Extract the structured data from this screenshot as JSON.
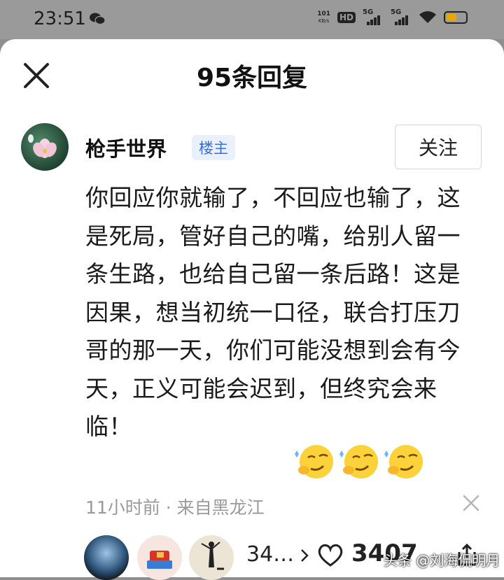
{
  "status_bar": {
    "time": "23:51",
    "net_speed_value": "101",
    "net_speed_unit": "KB/s",
    "hd_label": "HD",
    "sim1_label": "5G",
    "sim2_label": "5G",
    "battery_color": "#e8a800"
  },
  "header": {
    "title": "95条回复",
    "close_icon": "close-icon"
  },
  "comment": {
    "author": "枪手世界",
    "badge": "楼主",
    "follow_label": "关注",
    "text": "你回应你就输了，不回应也输了，这是死局，管好自己的嘴，给别人留一条生路，也给自己留一条后路！这是因果，想当初统一口径，联合打压刀哥的那一天，你们可能没想到会有今天，正义可能会迟到，但终究会来临！",
    "emoji_count": 3,
    "meta": "11小时前 · 来自黑龙江"
  },
  "footer": {
    "likers_count": "34…",
    "like_count": "3407",
    "watermark": "头条 @刘海侃明月"
  }
}
